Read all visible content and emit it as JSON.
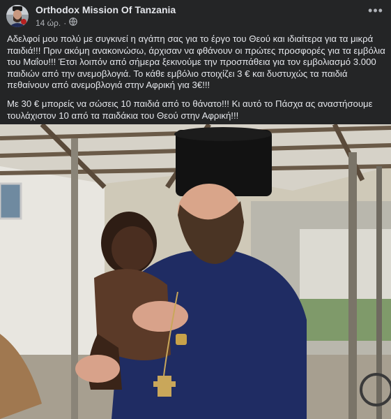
{
  "post": {
    "author": "Orthodox Mission Of Tanzania",
    "time": "14 ώρ.",
    "separator": "·",
    "more_label": "•••",
    "paragraphs": [
      "Αδελφοί μου πολύ με συγκινεί η αγάπη σας για το έργο του Θεού και ιδιαίτερα για τα μικρά παιδιά!!! Πριν ακόμη ανακοινώσω, άρχισαν να φθάνουν οι πρώτες προσφορές για τα εμβόλια του Μαΐου!!! Έτσι λοιπόν από σήμερα ξεκινούμε την προσπάθεια για τον εμβολιασμό 3.000 παιδιών από την ανεμοβλογιά. Το κάθε εμβόλιο στοιχίζει 3 € και δυστυχώς τα παιδιά πεθαίνουν από ανεμοβλογιά στην Αφρική για 3€!!!",
      "Με 30 € μπορείς να σώσεις 10 παιδιά από το θάνατο!!! Κι αυτό το Πάσχα ας αναστήσουμε τουλάχιστον 10 από τα παιδάκια του Θεού στην Αφρική!!!"
    ]
  }
}
